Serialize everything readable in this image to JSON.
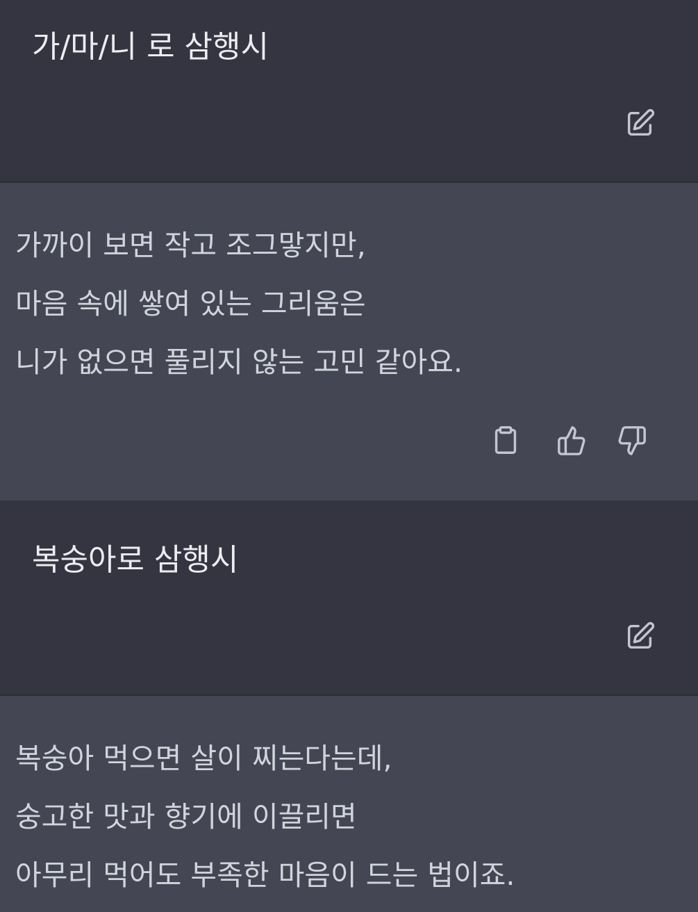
{
  "conversation": [
    {
      "prompt": "가/마/니 로 삼행시",
      "response_lines": [
        "가까이 보면 작고 조그맣지만,",
        "마음 속에 쌓여 있는 그리움은",
        "니가 없으면 풀리지 않는 고민 같아요."
      ]
    },
    {
      "prompt": "복숭아로 삼행시",
      "response_lines": [
        "복숭아 먹으면 살이 찌는다는데,",
        "숭고한 맛과 향기에 이끌리면",
        "아무리 먹어도 부족한 마음이 드는 법이죠."
      ]
    }
  ],
  "icons": {
    "edit": "edit-icon",
    "copy": "clipboard-icon",
    "like": "thumbs-up-icon",
    "dislike": "thumbs-down-icon"
  },
  "colors": {
    "user_bg": "#343541",
    "assistant_bg": "#444654",
    "user_text": "#ececf1",
    "assistant_text": "#d1d5db",
    "icon": "#c5c5d2"
  }
}
